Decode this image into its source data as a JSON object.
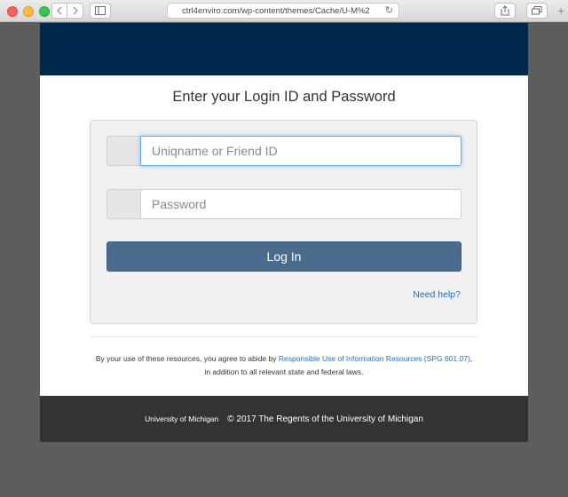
{
  "browser": {
    "url": "ctrl4enviro.com/wp-content/themes/Cache/U-M%2"
  },
  "login": {
    "title": "Enter your Login ID and Password",
    "username_placeholder": "Uniqname or Friend ID",
    "password_placeholder": "Password",
    "login_button": "Log In",
    "help_link": "Need help?"
  },
  "terms": {
    "prefix": "By your use of these resources, you agree to abide by ",
    "link": "Responsible Use of Information Resources (SPG 601.07)",
    "suffix": ", in addition to all relevant state and federal laws."
  },
  "footer": {
    "org": "University of Michigan",
    "copyright": "© 2017 The Regents of the University of Michigan"
  },
  "colors": {
    "header_band": "#00274c",
    "login_button": "#4a6b8e",
    "link": "#2a6fb0",
    "footer": "#333333"
  }
}
